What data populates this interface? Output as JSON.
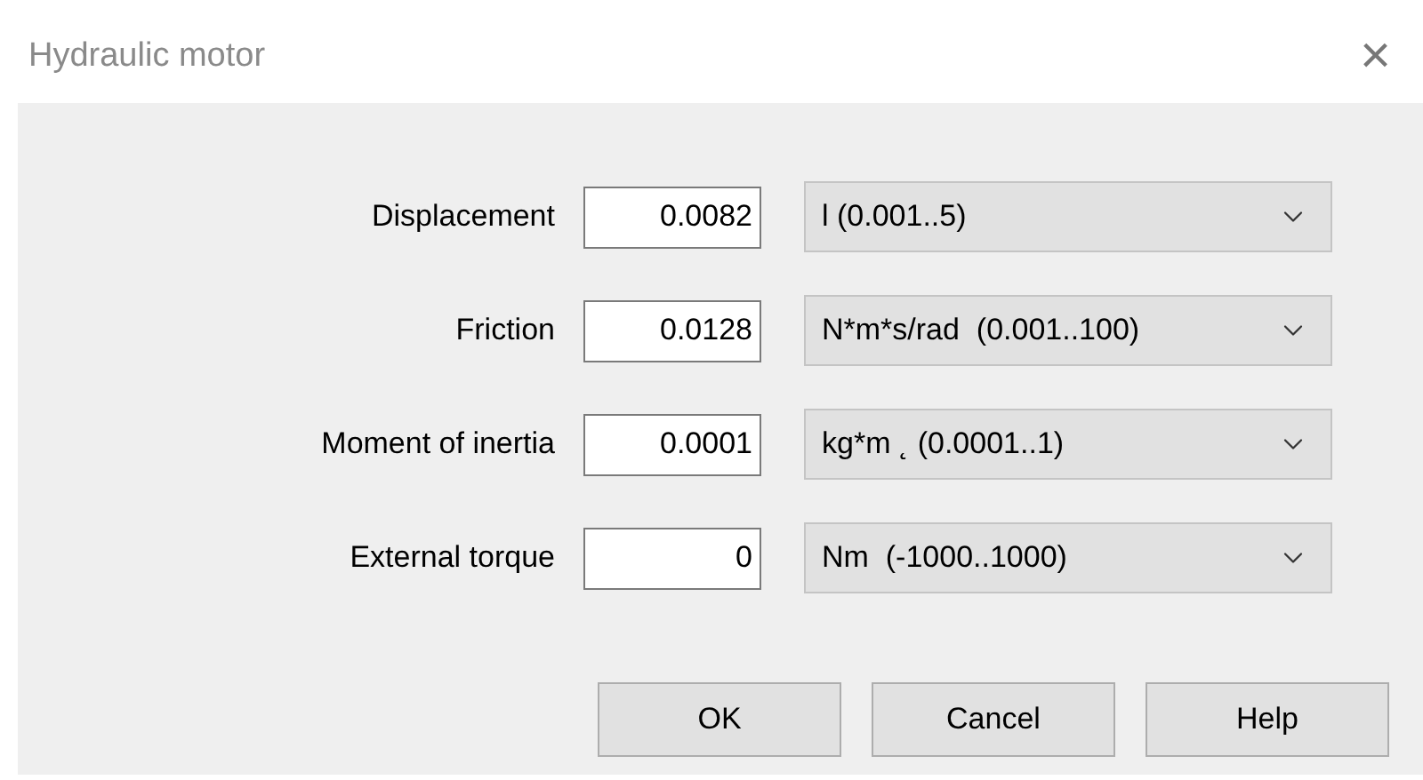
{
  "window": {
    "title": "Hydraulic motor",
    "close": "×"
  },
  "fields": [
    {
      "label": "Displacement",
      "value": "0.0082",
      "unit": "l (0.001..5)"
    },
    {
      "label": "Friction",
      "value": "0.0128",
      "unit": "N*m*s/rad  (0.001..100)"
    },
    {
      "label": "Moment of inertia",
      "value": "0.0001",
      "unit": "kg*m ˛ (0.0001..1)"
    },
    {
      "label": "External torque",
      "value": "0",
      "unit": "Nm  (-1000..1000)"
    }
  ],
  "buttons": [
    "OK",
    "Cancel",
    "Help"
  ]
}
